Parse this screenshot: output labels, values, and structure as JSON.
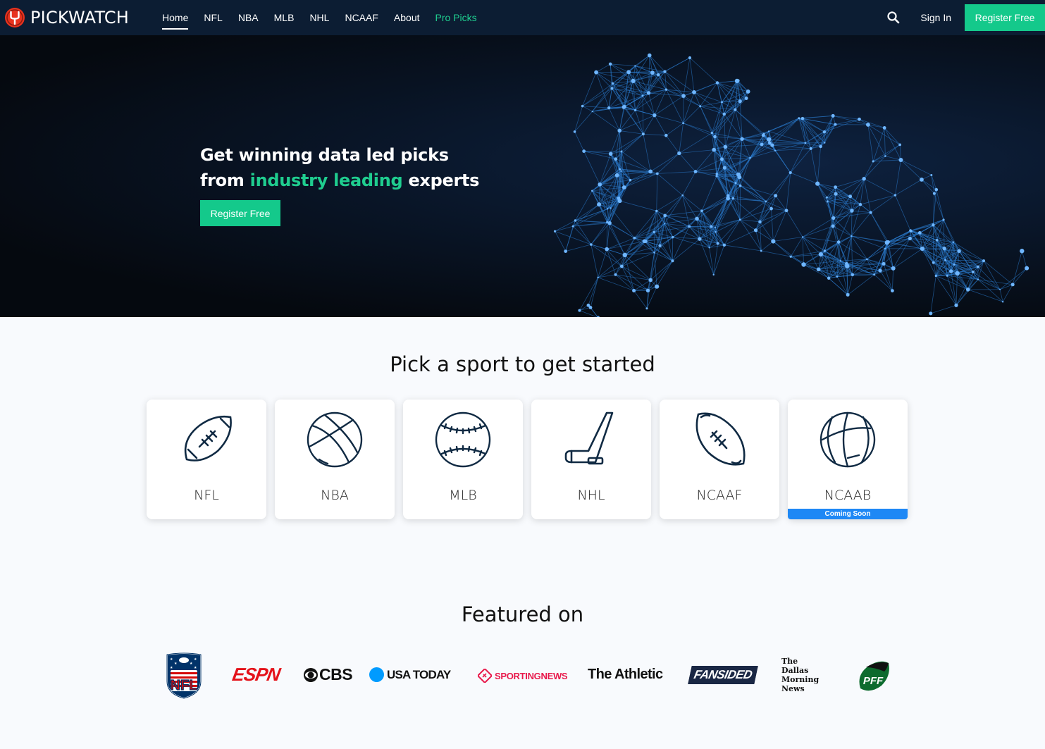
{
  "nav": {
    "brand": "PICKWATCH",
    "links": [
      {
        "label": "Home"
      },
      {
        "label": "NFL"
      },
      {
        "label": "NBA"
      },
      {
        "label": "MLB"
      },
      {
        "label": "NHL"
      },
      {
        "label": "NCAAF"
      },
      {
        "label": "About"
      },
      {
        "label": "Pro Picks"
      }
    ],
    "active": "Home",
    "sign_in": "Sign In",
    "register": "Register Free",
    "icons": {
      "search": "search-icon",
      "logo": "goalpost-logo-icon"
    }
  },
  "hero": {
    "line1": "Get winning data led picks",
    "line2_before": "from ",
    "line2_accent": "industry leading",
    "line2_after": " experts",
    "button": "Register Free",
    "art": "network-football-players-illustration"
  },
  "pick": {
    "title": "Pick a sport to get started",
    "sports": [
      {
        "label": "NFL",
        "icon": "football-icon"
      },
      {
        "label": "NBA",
        "icon": "basketball-icon"
      },
      {
        "label": "MLB",
        "icon": "baseball-icon"
      },
      {
        "label": "NHL",
        "icon": "hockey-stick-icon"
      },
      {
        "label": "NCAAF",
        "icon": "college-football-icon"
      },
      {
        "label": "NCAAB",
        "icon": "basketball-icon",
        "badge": "Coming Soon"
      }
    ]
  },
  "featured": {
    "title": "Featured on",
    "logos": [
      {
        "name": "NFL",
        "text": "NFL"
      },
      {
        "name": "ESPN",
        "text": "ESPN"
      },
      {
        "name": "CBS",
        "text": "CBS"
      },
      {
        "name": "USA TODAY",
        "text": "USA TODAY"
      },
      {
        "name": "Sporting News",
        "text": "SPORTINGNEWS"
      },
      {
        "name": "The Athletic",
        "text": "The Athletic"
      },
      {
        "name": "FanSided",
        "text": "FANSIDED"
      },
      {
        "name": "The Dallas Morning News",
        "text": "The Dallas Morning News"
      },
      {
        "name": "PFF",
        "text": "PFF"
      }
    ]
  },
  "colors": {
    "nav_bg": "#0c1d33",
    "accent": "#14c98b",
    "accent_text": "#1fcd8f",
    "badge": "#1e88f5",
    "icon_stroke": "#102a43"
  }
}
